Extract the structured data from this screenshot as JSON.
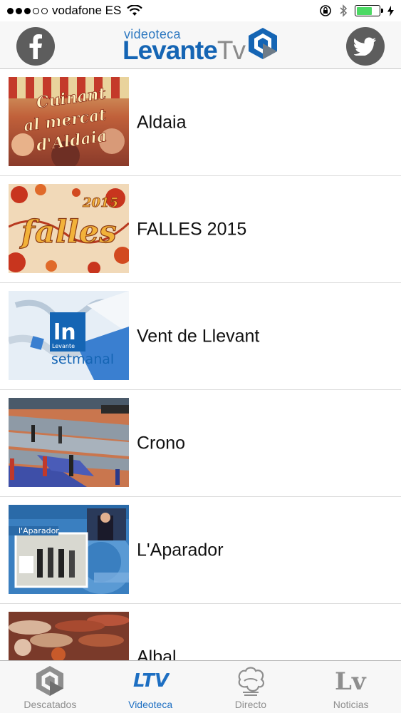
{
  "status_bar": {
    "carrier": "vodafone ES",
    "battery_level": 0.7
  },
  "header": {
    "logo_small": "videoteca",
    "logo_main": "Levante",
    "logo_tv": "Tv",
    "facebook_icon": "facebook-icon",
    "twitter_icon": "twitter-icon"
  },
  "list": {
    "items": [
      {
        "title": "Aldaia",
        "thumb_text": [
          "Cuinant",
          "al mercat",
          "d'Aldaia"
        ]
      },
      {
        "title": "FALLES 2015",
        "thumb_text": [
          "falles",
          "2015"
        ]
      },
      {
        "title": "Vent de Llevant",
        "thumb_text": [
          "ln",
          "Levante",
          "setmanal"
        ]
      },
      {
        "title": "Crono"
      },
      {
        "title": "L'Aparador",
        "thumb_text": [
          "l'Aparador"
        ]
      },
      {
        "title": "Albal"
      }
    ]
  },
  "tabbar": {
    "tabs": [
      {
        "label": "Descatados",
        "icon": "levante-cube-icon",
        "active": false
      },
      {
        "label": "Videoteca",
        "icon": "ltv-icon",
        "icon_text": "LTV",
        "active": true
      },
      {
        "label": "Directo",
        "icon": "hands-icon",
        "active": false
      },
      {
        "label": "Noticias",
        "icon": "lv-icon",
        "icon_text": "Lv",
        "active": false
      }
    ]
  },
  "colors": {
    "brand_blue": "#1565b4",
    "active_tab": "#1e6fc2",
    "inactive_tab": "#8e8e8e",
    "battery_green": "#4cd964"
  }
}
